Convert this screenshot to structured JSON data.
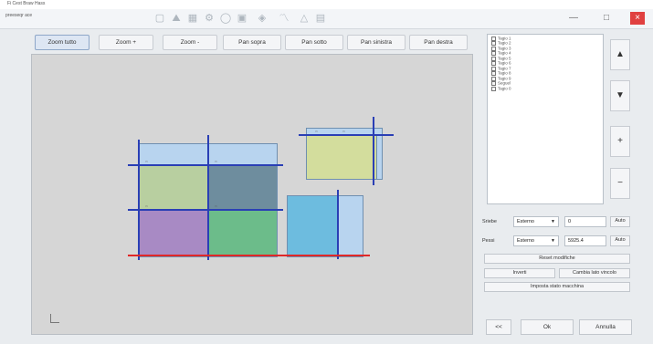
{
  "window": {
    "title": "Fi Cest Braw Hass",
    "document_name": "preeseqr ace"
  },
  "window_controls": {
    "minimize": "—",
    "maximize": "□",
    "close": "×"
  },
  "toolbar_icons": [
    "square-icon",
    "mountain-icon",
    "grid-icon",
    "gear-icon",
    "circle-icon",
    "box-icon",
    "cube-icon",
    "path-icon",
    "triangle-icon",
    "image-icon"
  ],
  "nav_buttons": [
    "Zoom tutto",
    "Zoom +",
    "Zoom -",
    "Pan sopra",
    "Pan sotto",
    "Pan sinistra",
    "Pan destra"
  ],
  "layers": [
    "Tagio 1",
    "Tagio 2",
    "Tagio 3",
    "Tagio 4",
    "Tagio 5",
    "Tagio 6",
    "Tagio 7",
    "Tagio 8",
    "Tagio 9",
    "Seguel",
    "Tagio 0"
  ],
  "side_buttons": {
    "up": "▲",
    "down": "▼",
    "add": "+",
    "remove": "−"
  },
  "params": {
    "spessore": {
      "label": "Sriebe",
      "select": "Esterno",
      "value": "0",
      "auto": "Auto"
    },
    "passo": {
      "label": "Pessi",
      "select": "Esterno",
      "value": "5925.4",
      "auto": "Auto"
    }
  },
  "actions": {
    "reset": "Reset modifiche",
    "inverti": "Inverti",
    "cambia_lato": "Cambia lato vincolo",
    "imposta": "Imposta stato macchina"
  },
  "footer": {
    "back": "<<",
    "ok": "Ok",
    "cancel": "Annulla"
  },
  "colors": {
    "canvas": "#d6d6d6",
    "light_blue": "#b8d4ef",
    "green": "#b8cfa0",
    "slate": "#6e8d9e",
    "purple": "#a88ac4",
    "teal_green": "#6cbc8a",
    "cyan": "#6dbcdf",
    "pale_green": "#d3dd9d",
    "blue_line": "#2a3fb5",
    "red_line": "#e02828"
  }
}
